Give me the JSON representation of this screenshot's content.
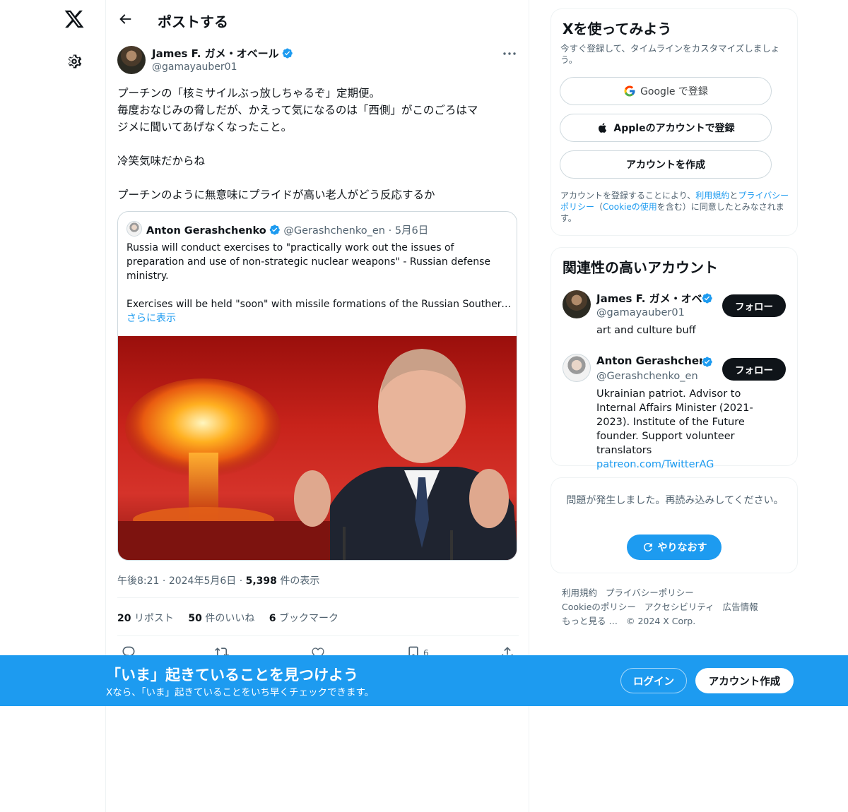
{
  "header": {
    "title": "ポストする"
  },
  "tweet": {
    "author_name": "James F. ガメ・オベール",
    "author_handle": "@gamayauber01",
    "text_lines": [
      "プーチンの「核ミサイルぶっ放しちゃるぞ」定期便。",
      "毎度おなじみの脅しだが、かえって気になるのは「西側」がこのごろはマ",
      "ジメに聞いてあげなくなったこと。",
      "冷笑気味だからね",
      "プーチンのように無意味にプライドが高い老人がどう反応するか"
    ],
    "time": "午後8:21",
    "date": "2024年5月6日",
    "views_count": "5,398",
    "views_label": "件の表示",
    "reposts_count": "20",
    "reposts_label": "リポスト",
    "likes_count": "50",
    "likes_label": "件のいいね",
    "bookmarks_count": "6",
    "bookmarks_label": "ブックマーク",
    "bookmark_action_count": "6"
  },
  "quote": {
    "name": "Anton Gerashchenko",
    "handle": "@Gerashchenko_en",
    "date": "5月6日",
    "text_1": "Russia will conduct exercises to \"practically work out the issues of preparation and use of non-strategic nuclear weapons\" - Russian defense ministry.",
    "text_2": "Exercises will be held \"soon\" with missile formations of the Russian Southern Military District",
    "show_more": "さらに表示"
  },
  "signup_card": {
    "title": "Xを使ってみよう",
    "subtitle": "今すぐ登録して、タイムラインをカスタマイズしましょう。",
    "google_label": "Google で登録",
    "apple_label": "Appleのアカウントで登録",
    "create_label": "アカウントを作成",
    "legal_1": "アカウントを登録することにより、",
    "legal_terms": "利用規約",
    "legal_2": "と",
    "legal_privacy": "プライバシーポリシー",
    "legal_3": "（",
    "legal_cookie": "Cookieの使用",
    "legal_4": "を含む）に同意したとみなされます。"
  },
  "related": {
    "title": "関連性の高いアカウント",
    "accounts": [
      {
        "name": "James F. ガメ・オベール",
        "handle": "@gamayauber01",
        "bio": "art and culture buff",
        "follow_label": "フォロー"
      },
      {
        "name": "Anton Gerashchenko",
        "handle": "@Gerashchenko_en",
        "bio": "Ukrainian patriot. Advisor to Internal Affairs Minister (2021-2023). Institute of the Future founder. Support volunteer translators",
        "link": "patreon.com/TwitterAG",
        "follow_label": "フォロー"
      }
    ]
  },
  "error_card": {
    "message": "問題が発生しました。再読み込みしてください。",
    "retry_label": "やりなおす"
  },
  "footer": {
    "links": [
      "利用規約",
      "プライバシーポリシー",
      "Cookieのポリシー",
      "アクセシビリティ",
      "広告情報",
      "もっと見る …"
    ],
    "copyright": "© 2024 X Corp."
  },
  "banner": {
    "title": "「いま」起きていることを見つけよう",
    "subtitle": "Xなら、「いま」起きていることをいち早くチェックできます。",
    "login_label": "ログイン",
    "signup_label": "アカウント作成"
  },
  "colors": {
    "accent": "#1d9bf0",
    "text": "#0f1419",
    "secondary": "#536471"
  },
  "icons": [
    "x-logo-icon",
    "settings-gear-icon",
    "back-arrow-icon",
    "verified-badge-icon",
    "more-icon",
    "reply-icon",
    "repost-icon",
    "like-icon",
    "bookmark-icon",
    "share-icon",
    "google-icon",
    "apple-icon",
    "refresh-icon"
  ]
}
